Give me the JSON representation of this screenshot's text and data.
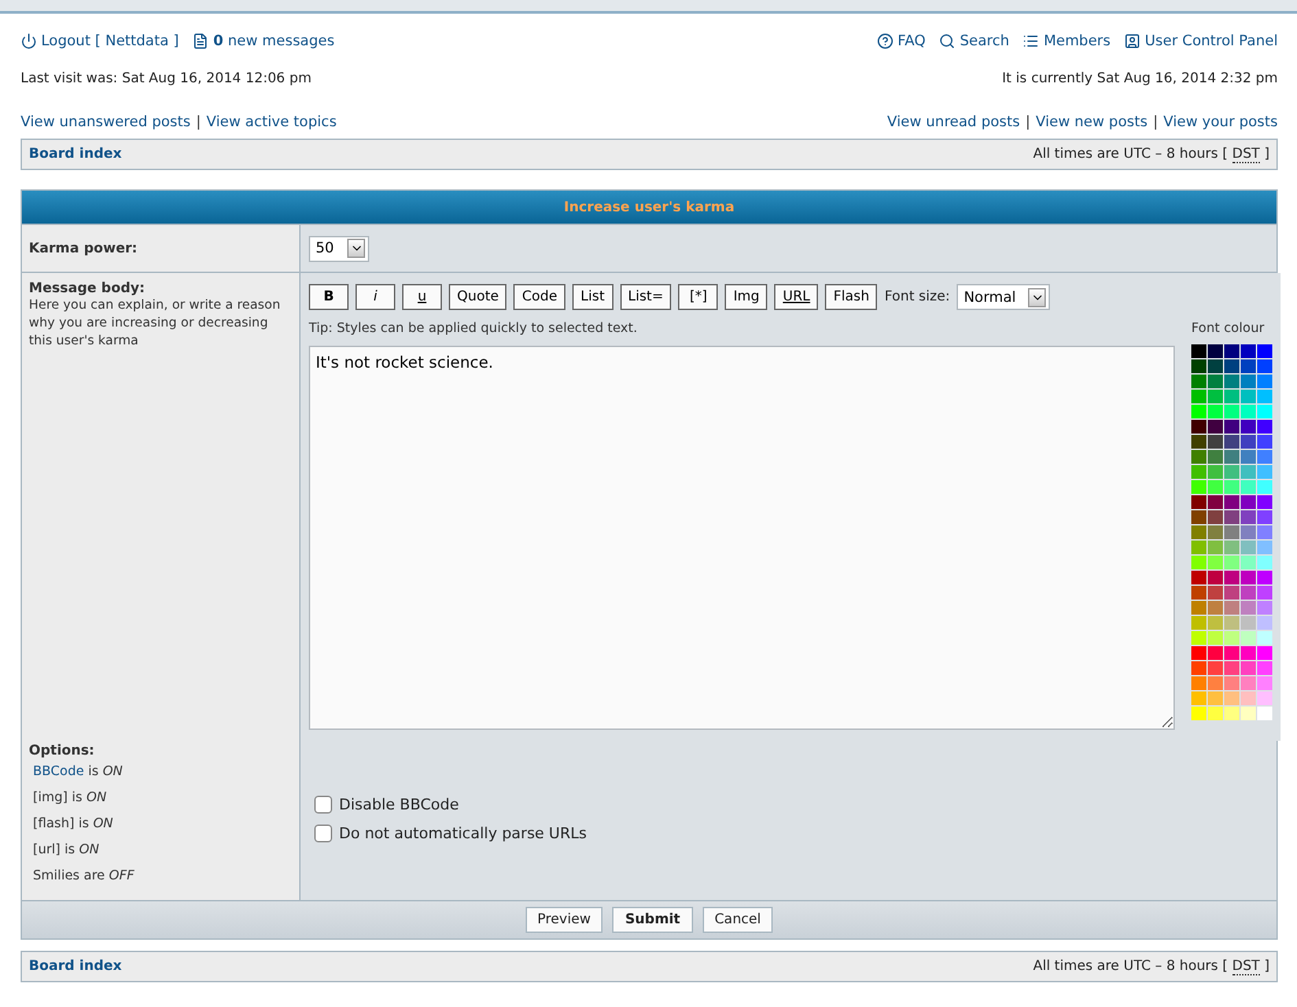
{
  "header": {
    "logout": "Logout [ Nettdata ]",
    "messages": "**0** new messages",
    "links": [
      {
        "kind": "faq",
        "label": "FAQ"
      },
      {
        "kind": "search",
        "label": "Search"
      },
      {
        "kind": "members",
        "label": "Members"
      },
      {
        "kind": "ucp",
        "label": "User Control Panel"
      }
    ],
    "last_visit": "Last visit was: Sat Aug 16, 2014 12:06 pm",
    "current_time": "It is currently Sat Aug 16, 2014 2:32 pm"
  },
  "quick_links_left": [
    {
      "label": "View unanswered posts"
    },
    {
      "separator": "|",
      "label": "View active topics"
    }
  ],
  "quick_links_right": [
    {
      "label": "View unread posts"
    },
    {
      "separator": "|",
      "label": "View new posts"
    },
    {
      "separator": "|",
      "label": "View your posts"
    }
  ],
  "nav_top": {
    "crumb": "Board index",
    "times": "All times are UTC – 8 hours [",
    "dst": "DST",
    "close": "]"
  },
  "form": {
    "title": "Increase user's karma",
    "karma": {
      "label": "Karma power:",
      "value": "50"
    },
    "message": {
      "label": "Message body:",
      "help": "Here you can explain, or write a reason why you are increasing or decreasing this user's karma",
      "toolbar": [
        {
          "label": "B",
          "kind": "bold"
        },
        {
          "label": "i",
          "kind": "italic"
        },
        {
          "label": "u",
          "kind": "underline"
        },
        {
          "label": "Quote",
          "kind": "plain"
        },
        {
          "label": "Code",
          "kind": "plain"
        },
        {
          "label": "List",
          "kind": "plain"
        },
        {
          "label": "List=",
          "kind": "plain"
        },
        {
          "label": "[*]",
          "kind": "plain"
        },
        {
          "label": "Img",
          "kind": "plain"
        },
        {
          "label": "URL",
          "kind": "underline"
        },
        {
          "label": "Flash",
          "kind": "plain"
        }
      ],
      "font_size_label": "Font size:",
      "font_size": "Normal",
      "tip": "Tip: Styles can be applied quickly to selected text.",
      "value": "It's not rocket science.",
      "palette_label": "Font colour",
      "palette": [
        [
          {
            "color": "#000000"
          },
          {
            "color": "#000040"
          },
          {
            "color": "#000080"
          },
          {
            "color": "#0000bf"
          },
          {
            "color": "#0000ff"
          }
        ],
        [
          {
            "color": "#004000"
          },
          {
            "color": "#004040"
          },
          {
            "color": "#004080"
          },
          {
            "color": "#0040bf"
          },
          {
            "color": "#0040ff"
          }
        ],
        [
          {
            "color": "#008000"
          },
          {
            "color": "#008040"
          },
          {
            "color": "#008080"
          },
          {
            "color": "#0080bf"
          },
          {
            "color": "#0080ff"
          }
        ],
        [
          {
            "color": "#00bf00"
          },
          {
            "color": "#00bf40"
          },
          {
            "color": "#00bf80"
          },
          {
            "color": "#00bfbf"
          },
          {
            "color": "#00bfff"
          }
        ],
        [
          {
            "color": "#00ff00"
          },
          {
            "color": "#00ff40"
          },
          {
            "color": "#00ff80"
          },
          {
            "color": "#00ffbf"
          },
          {
            "color": "#00ffff"
          }
        ],
        [
          {
            "color": "#400000"
          },
          {
            "color": "#400040"
          },
          {
            "color": "#400080"
          },
          {
            "color": "#4000bf"
          },
          {
            "color": "#4000ff"
          }
        ],
        [
          {
            "color": "#404000"
          },
          {
            "color": "#404040"
          },
          {
            "color": "#404080"
          },
          {
            "color": "#4040bf"
          },
          {
            "color": "#4040ff"
          }
        ],
        [
          {
            "color": "#408000"
          },
          {
            "color": "#408040"
          },
          {
            "color": "#408080"
          },
          {
            "color": "#4080bf"
          },
          {
            "color": "#4080ff"
          }
        ],
        [
          {
            "color": "#40bf00"
          },
          {
            "color": "#40bf40"
          },
          {
            "color": "#40bf80"
          },
          {
            "color": "#40bfbf"
          },
          {
            "color": "#40bfff"
          }
        ],
        [
          {
            "color": "#40ff00"
          },
          {
            "color": "#40ff40"
          },
          {
            "color": "#40ff80"
          },
          {
            "color": "#40ffbf"
          },
          {
            "color": "#40ffff"
          }
        ],
        [
          {
            "color": "#800000"
          },
          {
            "color": "#800040"
          },
          {
            "color": "#800080"
          },
          {
            "color": "#8000bf"
          },
          {
            "color": "#8000ff"
          }
        ],
        [
          {
            "color": "#804000"
          },
          {
            "color": "#804040"
          },
          {
            "color": "#804080"
          },
          {
            "color": "#8040bf"
          },
          {
            "color": "#8040ff"
          }
        ],
        [
          {
            "color": "#808000"
          },
          {
            "color": "#808040"
          },
          {
            "color": "#808080"
          },
          {
            "color": "#8080bf"
          },
          {
            "color": "#8080ff"
          }
        ],
        [
          {
            "color": "#80bf00"
          },
          {
            "color": "#80bf40"
          },
          {
            "color": "#80bf80"
          },
          {
            "color": "#80bfbf"
          },
          {
            "color": "#80bfff"
          }
        ],
        [
          {
            "color": "#80ff00"
          },
          {
            "color": "#80ff40"
          },
          {
            "color": "#80ff80"
          },
          {
            "color": "#80ffbf"
          },
          {
            "color": "#80ffff"
          }
        ],
        [
          {
            "color": "#bf0000"
          },
          {
            "color": "#bf0040"
          },
          {
            "color": "#bf0080"
          },
          {
            "color": "#bf00bf"
          },
          {
            "color": "#bf00ff"
          }
        ],
        [
          {
            "color": "#bf4000"
          },
          {
            "color": "#bf4040"
          },
          {
            "color": "#bf4080"
          },
          {
            "color": "#bf40bf"
          },
          {
            "color": "#bf40ff"
          }
        ],
        [
          {
            "color": "#bf8000"
          },
          {
            "color": "#bf8040"
          },
          {
            "color": "#bf8080"
          },
          {
            "color": "#bf80bf"
          },
          {
            "color": "#bf80ff"
          }
        ],
        [
          {
            "color": "#bfbf00"
          },
          {
            "color": "#bfbf40"
          },
          {
            "color": "#bfbf80"
          },
          {
            "color": "#bfbfbf"
          },
          {
            "color": "#bfbfff"
          }
        ],
        [
          {
            "color": "#bfff00"
          },
          {
            "color": "#bfff40"
          },
          {
            "color": "#bfff80"
          },
          {
            "color": "#bfffbf"
          },
          {
            "color": "#bfffff"
          }
        ],
        [
          {
            "color": "#ff0000"
          },
          {
            "color": "#ff0040"
          },
          {
            "color": "#ff0080"
          },
          {
            "color": "#ff00bf"
          },
          {
            "color": "#ff00ff"
          }
        ],
        [
          {
            "color": "#ff4000"
          },
          {
            "color": "#ff4040"
          },
          {
            "color": "#ff4080"
          },
          {
            "color": "#ff40bf"
          },
          {
            "color": "#ff40ff"
          }
        ],
        [
          {
            "color": "#ff8000"
          },
          {
            "color": "#ff8040"
          },
          {
            "color": "#ff8080"
          },
          {
            "color": "#ff80bf"
          },
          {
            "color": "#ff80ff"
          }
        ],
        [
          {
            "color": "#ffbf00"
          },
          {
            "color": "#ffbf40"
          },
          {
            "color": "#ffbf80"
          },
          {
            "color": "#ffbfbf"
          },
          {
            "color": "#ffbfff"
          }
        ],
        [
          {
            "color": "#ffff00"
          },
          {
            "color": "#ffff40"
          },
          {
            "color": "#ffff80"
          },
          {
            "color": "#ffffbf"
          },
          {
            "color": "#ffffff"
          }
        ]
      ]
    },
    "options": {
      "label": "Options:",
      "items": [
        {
          "link": "BBCode",
          "text": "is *ON*"
        },
        {
          "text": "[img] is *ON*"
        },
        {
          "text": "[flash] is *ON*"
        },
        {
          "text": "[url] is *ON*"
        },
        {
          "text": "Smilies are *OFF*"
        }
      ],
      "checkboxes": [
        {
          "label": "Disable BBCode",
          "checked": false
        },
        {
          "label": "Do not automatically parse URLs",
          "checked": false
        }
      ]
    },
    "buttons": [
      {
        "label": "Preview",
        "primary": false
      },
      {
        "label": "Submit",
        "primary": true
      },
      {
        "label": "Cancel",
        "primary": false
      }
    ]
  },
  "nav_bottom": {
    "crumb": "Board index",
    "times": "All times are UTC – 8 hours [",
    "dst": "DST",
    "close": "]"
  }
}
